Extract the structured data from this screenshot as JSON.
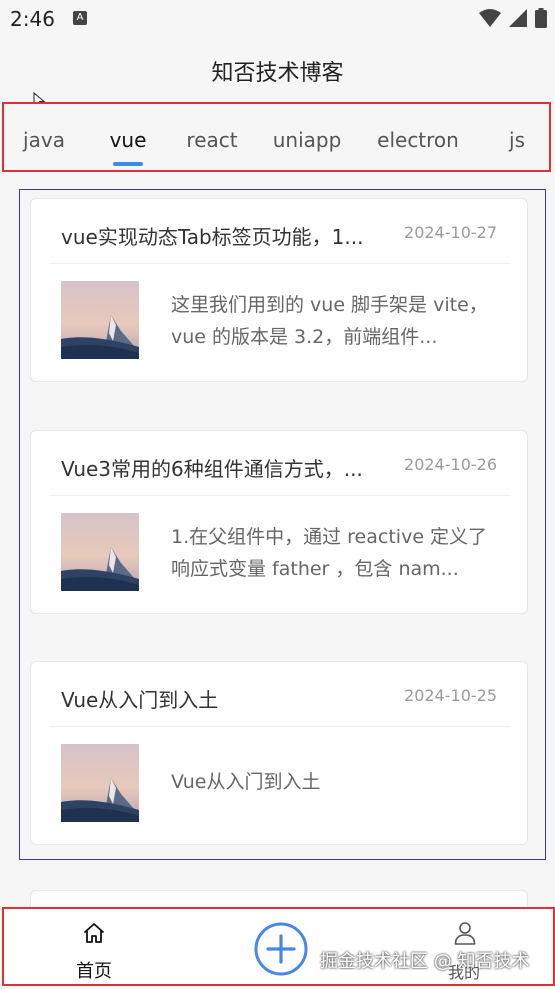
{
  "status_bar": {
    "time": "2:46",
    "notification_glyph": "A"
  },
  "app": {
    "title": "知否技术博客"
  },
  "tabs": [
    {
      "label": "java",
      "active": false
    },
    {
      "label": "vue",
      "active": true
    },
    {
      "label": "react",
      "active": false
    },
    {
      "label": "uniapp",
      "active": false
    },
    {
      "label": "electron",
      "active": false
    },
    {
      "label": "js",
      "active": false
    }
  ],
  "articles": [
    {
      "title": "vue实现动态Tab标签页功能，1...",
      "date": "2024-10-27",
      "summary": "这里我们用到的 vue 脚手架是 vite，vue 的版本是 3.2，前端组件..."
    },
    {
      "title": "Vue3常用的6种组件通信方式，...",
      "date": "2024-10-26",
      "summary": "1.在父组件中，通过 reactive 定义了响应式变量 father ，包含 nam..."
    },
    {
      "title": "Vue从入门到入土",
      "date": "2024-10-25",
      "summary": "Vue从入门到入土"
    }
  ],
  "bottom_nav": {
    "home_label": "首页",
    "mine_label": "我的",
    "home_icon": "home-icon",
    "add_icon": "plus-circle-icon",
    "mine_icon": "user-icon"
  },
  "watermark": "掘金技术社区 @ 知否技术",
  "colors": {
    "accent": "#3a8ee6",
    "add_button": "#4a86e8",
    "highlight_border": "#d9333a",
    "list_border": "#3d3d8f"
  }
}
